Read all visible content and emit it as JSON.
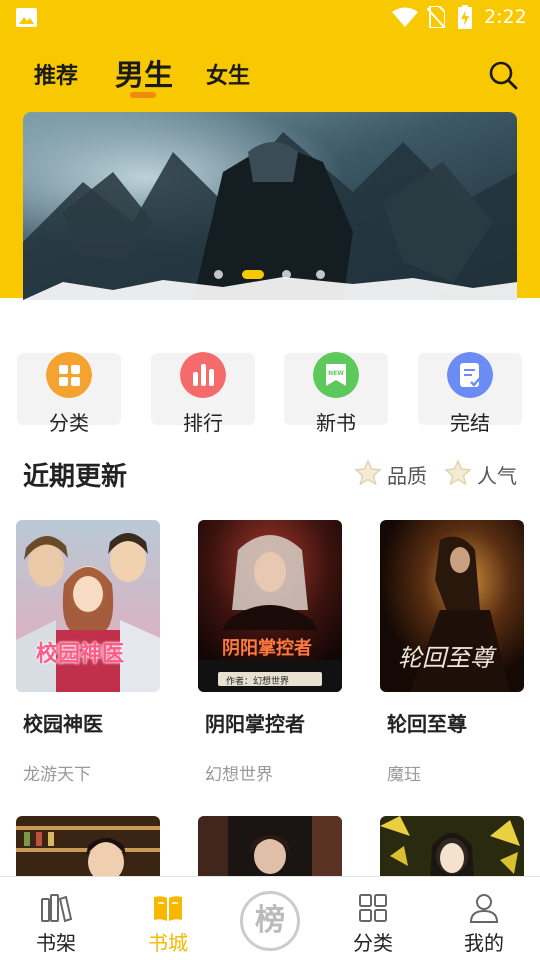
{
  "statusbar": {
    "time": "2:22",
    "icons": [
      "gallery-icon",
      "wifi-icon",
      "no-sim-icon",
      "battery-charging-icon"
    ]
  },
  "header": {
    "tabs": [
      {
        "label": "推荐",
        "active": false
      },
      {
        "label": "男生",
        "active": true
      },
      {
        "label": "女生",
        "active": false
      }
    ],
    "search_icon": "search-icon",
    "accent_color": "#F8C800",
    "indicator_color": "#F08A12"
  },
  "banner": {
    "page_count": 4,
    "active_index": 1
  },
  "quick_entries": [
    {
      "label": "分类",
      "icon": "grid-icon",
      "color": "#F5A330"
    },
    {
      "label": "排行",
      "icon": "bar-rank-icon",
      "color": "#F56B6B"
    },
    {
      "label": "新书",
      "icon": "new-book-icon",
      "color": "#5DC95D"
    },
    {
      "label": "完结",
      "icon": "finished-doc-icon",
      "color": "#6B8CF5"
    }
  ],
  "recent": {
    "title": "近期更新",
    "sort_options": [
      {
        "label": "品质",
        "icon": "star-icon"
      },
      {
        "label": "人气",
        "icon": "star-icon"
      }
    ],
    "books": [
      {
        "title": "校园神医",
        "author": "龙游天下",
        "cover_text": "校园神医"
      },
      {
        "title": "阴阳掌控者",
        "author": "幻想世界",
        "cover_text": "阴阳掌控者",
        "cover_subtext": "作者：幻想世界"
      },
      {
        "title": "轮回至尊",
        "author": "魔珏",
        "cover_text": "轮回至尊"
      }
    ]
  },
  "bottom_nav": {
    "items": [
      {
        "label": "书架",
        "icon": "bookshelf-icon",
        "active": false
      },
      {
        "label": "书城",
        "icon": "open-book-icon",
        "active": true
      },
      {
        "label": "榜",
        "icon": "rank-badge-icon",
        "active": false
      },
      {
        "label": "分类",
        "icon": "category-grid-icon",
        "active": false
      },
      {
        "label": "我的",
        "icon": "user-icon",
        "active": false
      }
    ]
  }
}
